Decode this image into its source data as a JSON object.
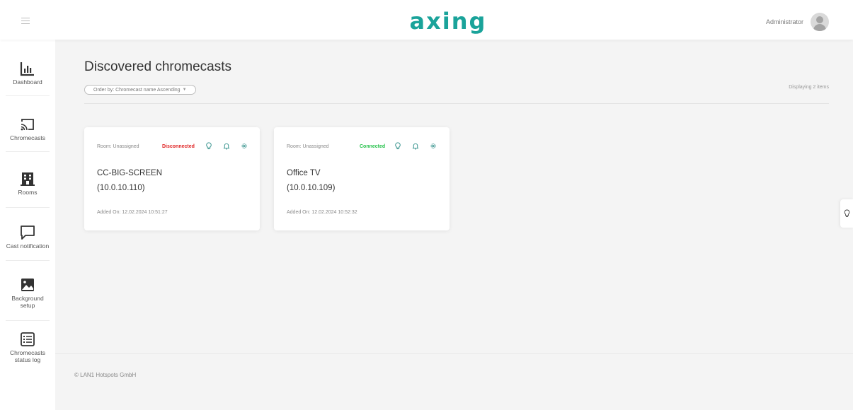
{
  "header": {
    "brand": "axing",
    "user_name": "Administrator"
  },
  "sidebar": {
    "items": [
      {
        "label": "Dashboard",
        "icon": "bar-chart-icon"
      },
      {
        "label": "Chromecasts",
        "icon": "cast-icon"
      },
      {
        "label": "Rooms",
        "icon": "building-icon"
      },
      {
        "label": "Cast notification",
        "icon": "message-icon"
      },
      {
        "label": "Background setup",
        "icon": "image-icon"
      },
      {
        "label": "Chromecasts status log",
        "icon": "list-icon"
      }
    ]
  },
  "main": {
    "title": "Discovered chromecasts",
    "order_label": "Order by: Chromecast name Ascending",
    "count_text": "Displaying 2 items",
    "cards": [
      {
        "room": "Room: Unassigned",
        "status": "Disconnected",
        "name": "CC-BIG-SCREEN",
        "ip": "(10.0.10.110)",
        "added": "Added On: 12.02.2024 10:51:27"
      },
      {
        "room": "Room: Unassigned",
        "status": "Connected",
        "name": "Office TV",
        "ip": "(10.0.10.109)",
        "added": "Added On: 12.02.2024 10:52:32"
      }
    ]
  },
  "footer": {
    "copyright": "© LAN1 Hotspots GmbH"
  },
  "colors": {
    "brand_teal": "#1aa39a",
    "disconnected": "#e02424",
    "connected": "#27c24c",
    "icon_teal": "#2a8c86"
  }
}
